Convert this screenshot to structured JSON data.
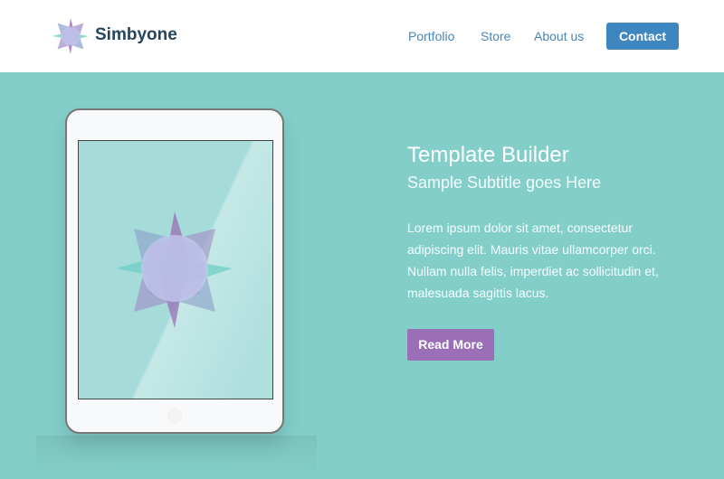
{
  "header": {
    "brand": "Simbyone",
    "nav": [
      "Portfolio",
      "Store",
      "About us"
    ],
    "contact_label": "Contact"
  },
  "hero": {
    "title": "Template Builder",
    "subtitle": "Sample Subtitle goes Here",
    "body": "Lorem ipsum dolor sit amet, consectetur adipiscing elit. Mauris vitae ullamcorper orci. Nullam nulla felis, imperdiet ac sollicitudin et, malesuada sagittis lacus.",
    "button_label": "Read More"
  },
  "colors": {
    "accent": "#3e86bf",
    "hero_bg": "#83cec9",
    "button": "#9a6fb6"
  }
}
